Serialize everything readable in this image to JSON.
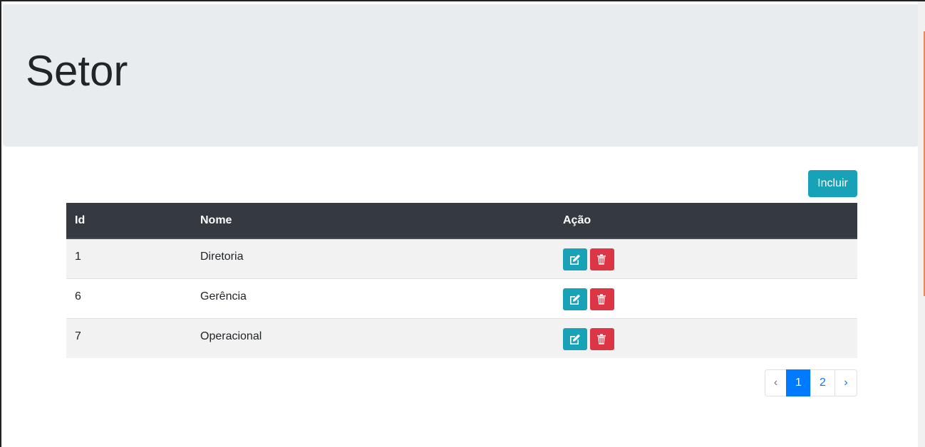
{
  "header": {
    "title": "Setor"
  },
  "toolbar": {
    "incluir_label": "Incluir"
  },
  "table": {
    "columns": [
      "Id",
      "Nome",
      "Ação"
    ],
    "rows": [
      {
        "id": "1",
        "nome": "Diretoria"
      },
      {
        "id": "6",
        "nome": "Gerência"
      },
      {
        "id": "7",
        "nome": "Operacional"
      }
    ]
  },
  "pagination": {
    "prev": "‹",
    "pages": [
      "1",
      "2"
    ],
    "active_page": "1",
    "next": "›"
  },
  "icons": {
    "edit": "edit-icon",
    "delete": "trash-icon"
  },
  "colors": {
    "jumbotron_bg": "#e9ecef",
    "header_bg": "#343a40",
    "info": "#17a2b8",
    "danger": "#dc3545",
    "primary": "#007bff"
  }
}
